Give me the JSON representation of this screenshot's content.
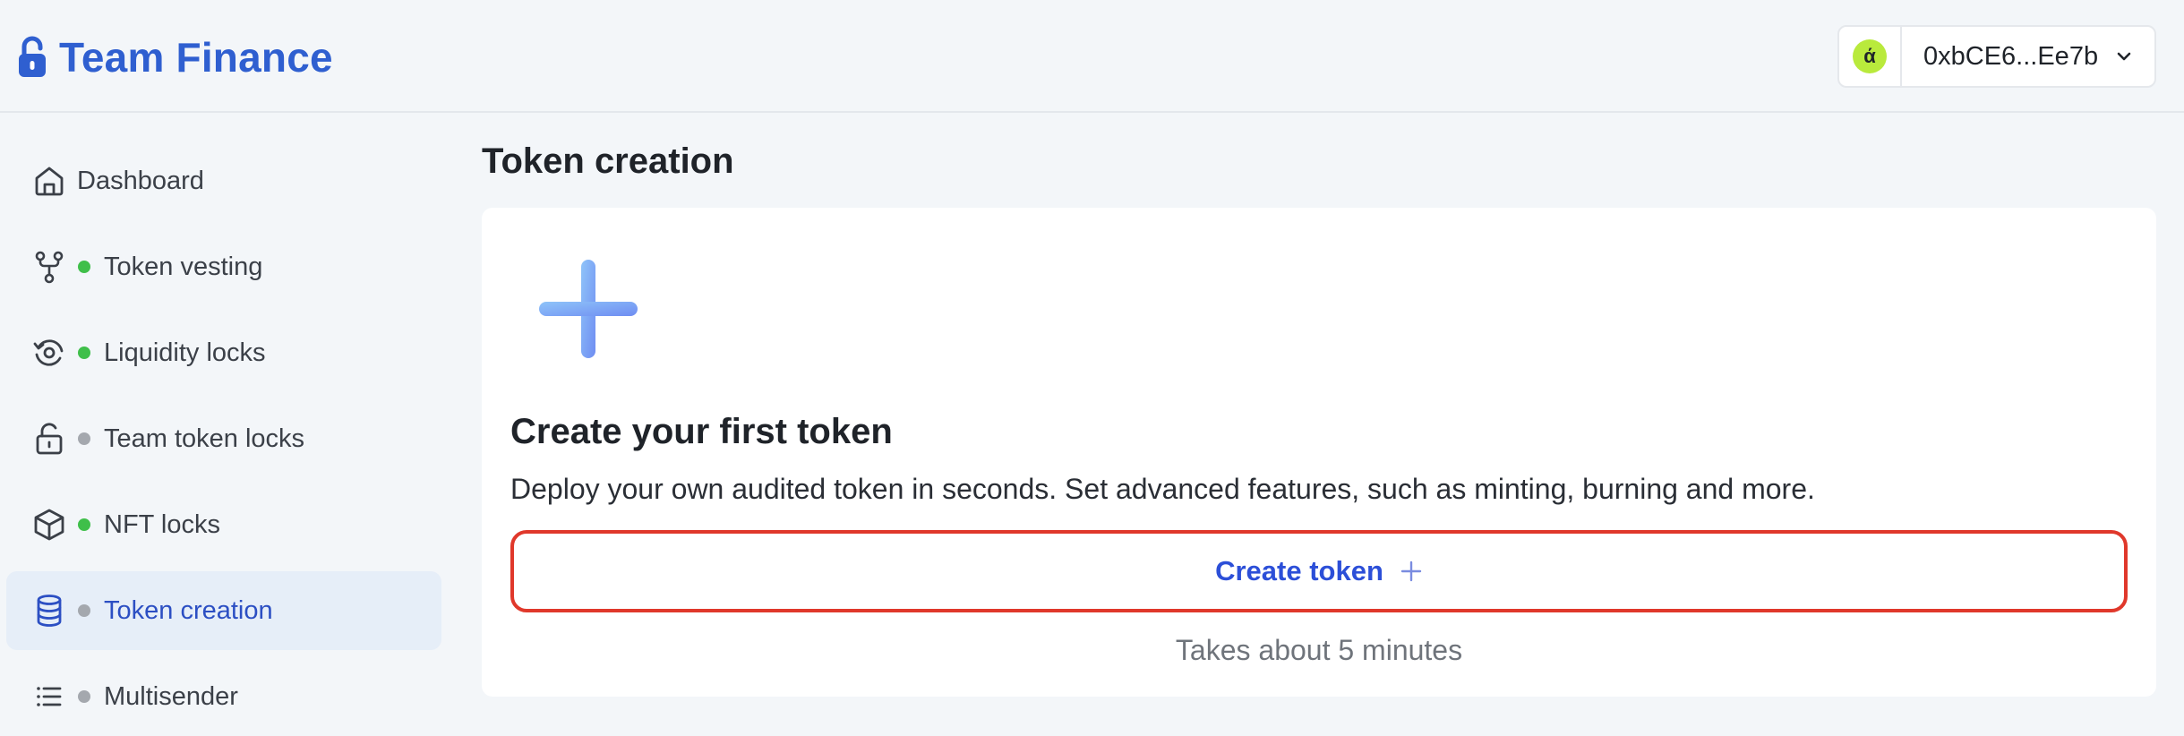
{
  "brand": {
    "name": "Team Finance",
    "icon": "padlock-icon",
    "color": "#2f5fd0"
  },
  "wallet": {
    "avatar_glyph": "ά",
    "address": "0xbCE6...Ee7b",
    "avatar_color": "#b9ea3c"
  },
  "sidebar": {
    "items": [
      {
        "label": "Dashboard",
        "icon": "home-icon",
        "status": null
      },
      {
        "label": "Token vesting",
        "icon": "branch-icon",
        "status": "#3fbf4a"
      },
      {
        "label": "Liquidity locks",
        "icon": "refresh-lock-icon",
        "status": "#3fbf4a"
      },
      {
        "label": "Team token locks",
        "icon": "unlock-icon",
        "status": "#a4a8ae"
      },
      {
        "label": "NFT locks",
        "icon": "cube-icon",
        "status": "#3fbf4a"
      },
      {
        "label": "Token creation",
        "icon": "database-icon",
        "status": "#a4a8ae",
        "active": true
      },
      {
        "label": "Multisender",
        "icon": "list-icon",
        "status": "#a4a8ae"
      }
    ]
  },
  "main": {
    "title": "Token creation",
    "card": {
      "icon": "plus-icon",
      "title": "Create your first token",
      "description": "Deploy your own audited token in seconds. Set advanced features, such as minting, burning and more.",
      "button_label": "Create token",
      "note": "Takes about 5 minutes"
    }
  },
  "colors": {
    "accent": "#2c4fd8",
    "highlight_border": "#e0382b"
  }
}
